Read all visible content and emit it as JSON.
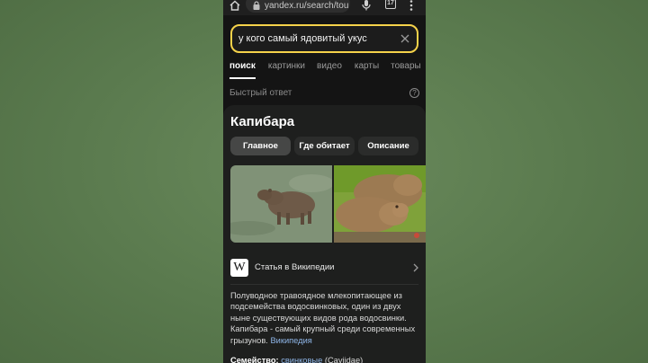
{
  "browser": {
    "url": "yandex.ru/search/tou",
    "tab_count": "17"
  },
  "search": {
    "query": "у кого самый ядовитый укус"
  },
  "tabs": [
    {
      "label": "поиск"
    },
    {
      "label": "картинки"
    },
    {
      "label": "видео"
    },
    {
      "label": "карты"
    },
    {
      "label": "товары"
    }
  ],
  "quick_answer": {
    "label": "Быстрый ответ"
  },
  "card": {
    "title": "Капибара",
    "pills": [
      {
        "label": "Главное"
      },
      {
        "label": "Где обитает"
      },
      {
        "label": "Описание"
      }
    ],
    "wiki_label": "Статья в Википедии",
    "description": "Полуводное травоядное млекопитающее из подсемейства водосвинковых, один из двух ныне существующих видов рода водосвинки. Капибара - самый крупный среди современных грызунов.",
    "description_link": "Википедия",
    "family_label": "Семейство:",
    "family_value": "свинковые",
    "family_latin": "(Caviidae)"
  },
  "colors": {
    "accent_search_border": "#f5d24a",
    "link": "#8fb6e8",
    "background": "#5b7a4f"
  },
  "icons": [
    "home-icon",
    "lock-icon",
    "microphone-icon",
    "tabs-icon",
    "menu-icon",
    "clear-icon",
    "help-icon",
    "wikipedia-icon",
    "chevron-right-icon"
  ]
}
